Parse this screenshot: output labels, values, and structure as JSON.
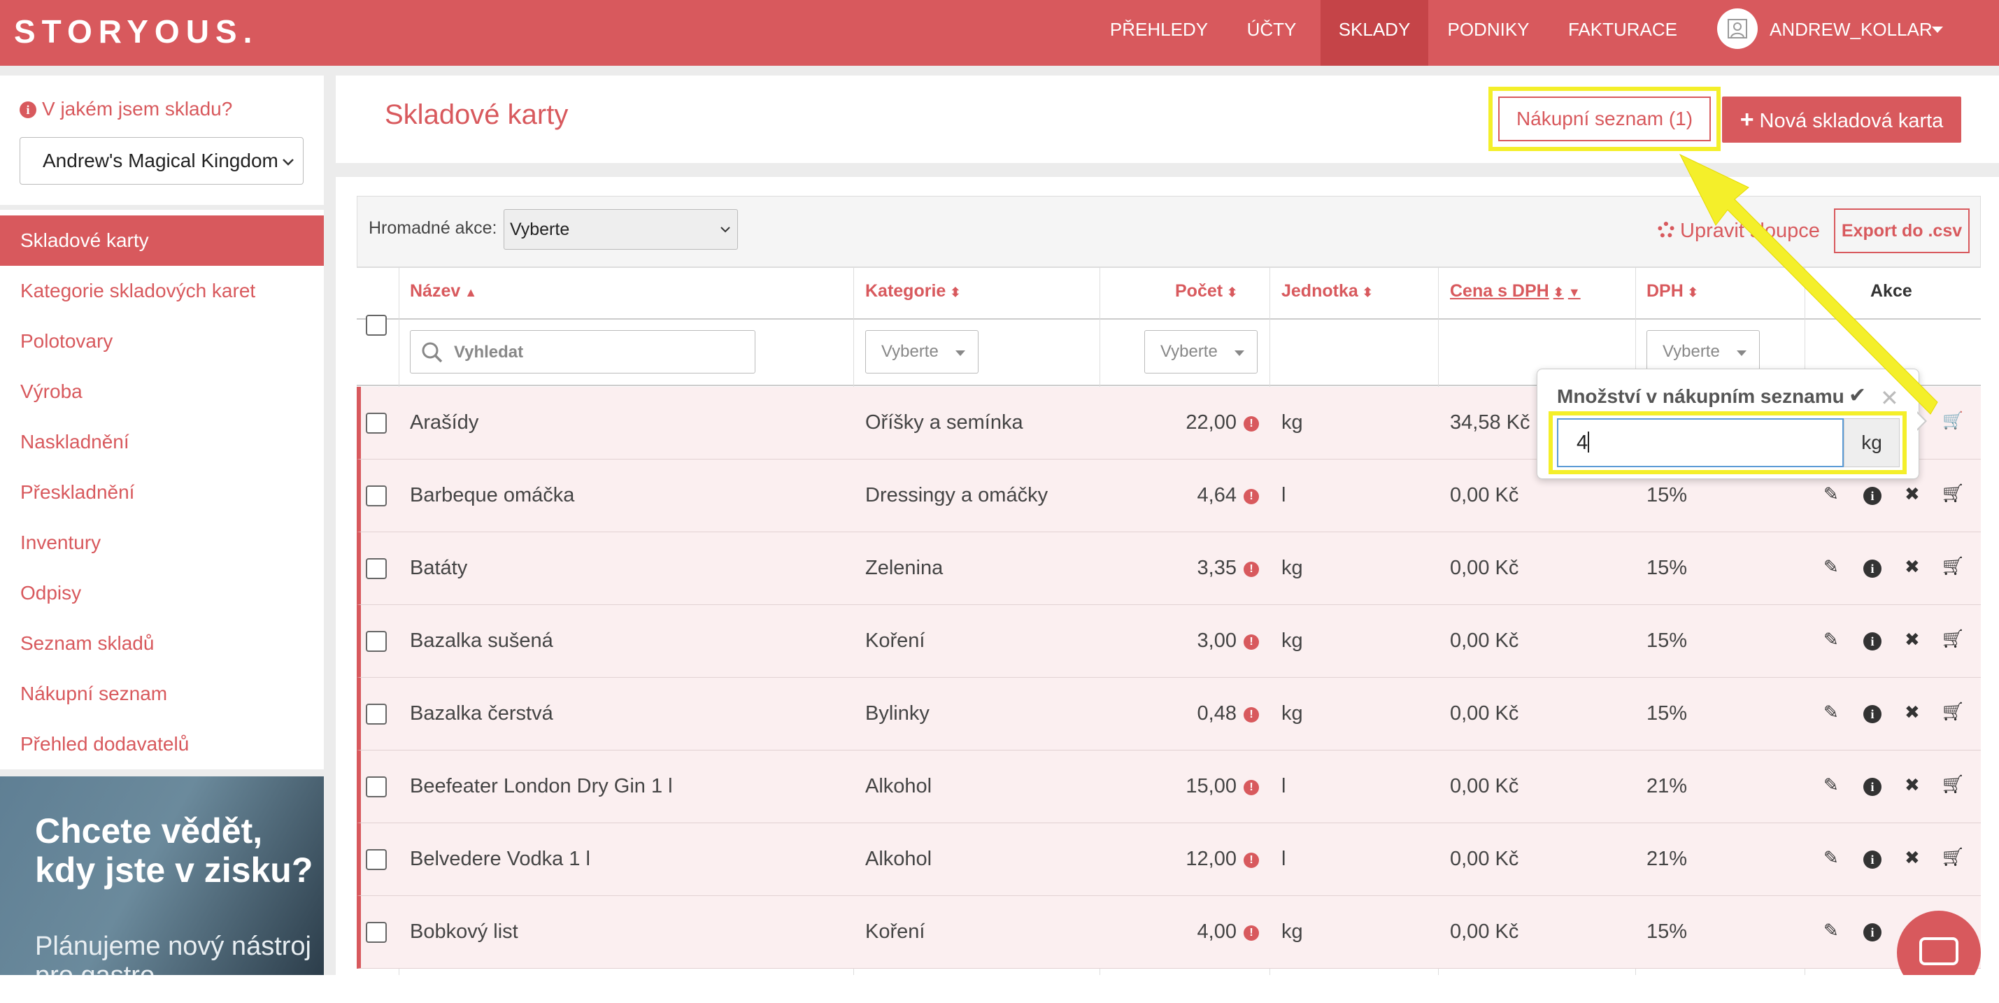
{
  "brand": {
    "logo": "STORYOUS."
  },
  "nav": {
    "items": [
      "PŘEHLEDY",
      "ÚČTY",
      "SKLADY",
      "PODNIKY",
      "FAKTURACE"
    ],
    "active": "SKLADY",
    "user": "ANDREW_KOLLAR"
  },
  "sidebar": {
    "which_warehouse": "V jakém jsem skladu?",
    "warehouse_value": "Andrew's Magical Kingdom",
    "items": [
      "Skladové karty",
      "Kategorie skladových karet",
      "Polotovary",
      "Výroba",
      "Naskladnění",
      "Přeskladnění",
      "Inventury",
      "Odpisy",
      "Seznam skladů",
      "Nákupní seznam",
      "Přehled dodavatelů"
    ],
    "active_index": 0,
    "promo_title": "Chcete vědět, kdy jste v zisku?",
    "promo_sub": "Plánujeme nový nástroj pro gastro"
  },
  "header": {
    "title": "Skladové karty",
    "shopping_list_button": "Nákupní seznam (1)",
    "new_card_button": "Nová skladová karta"
  },
  "toolbar": {
    "bulk_label": "Hromadné akce:",
    "bulk_value": "Vyberte",
    "edit_columns": "Upravit sloupce",
    "export": "Export do .csv"
  },
  "table": {
    "headers": [
      "Název",
      "Kategorie",
      "Počet",
      "Jednotka",
      "Cena s DPH",
      "DPH",
      "Akce"
    ],
    "search_placeholder": "Vyhledat",
    "filter_placeholder": "Vyberte",
    "rows": [
      {
        "name": "Arašídy",
        "category": "Oříšky a semínka",
        "count": "22,00",
        "unit": "kg",
        "price": "34,58 Kč",
        "vat": ""
      },
      {
        "name": "Barbeque omáčka",
        "category": "Dressingy a omáčky",
        "count": "4,64",
        "unit": "l",
        "price": "0,00 Kč",
        "vat": "15%"
      },
      {
        "name": "Batáty",
        "category": "Zelenina",
        "count": "3,35",
        "unit": "kg",
        "price": "0,00 Kč",
        "vat": "15%"
      },
      {
        "name": "Bazalka sušená",
        "category": "Koření",
        "count": "3,00",
        "unit": "kg",
        "price": "0,00 Kč",
        "vat": "15%"
      },
      {
        "name": "Bazalka čerstvá",
        "category": "Bylinky",
        "count": "0,48",
        "unit": "kg",
        "price": "0,00 Kč",
        "vat": "15%"
      },
      {
        "name": "Beefeater London Dry Gin 1 l",
        "category": "Alkohol",
        "count": "15,00",
        "unit": "l",
        "price": "0,00 Kč",
        "vat": "21%"
      },
      {
        "name": "Belvedere Vodka 1 l",
        "category": "Alkohol",
        "count": "12,00",
        "unit": "l",
        "price": "0,00 Kč",
        "vat": "21%"
      },
      {
        "name": "Bobkový list",
        "category": "Koření",
        "count": "4,00",
        "unit": "kg",
        "price": "0,00 Kč",
        "vat": "15%"
      }
    ]
  },
  "popover": {
    "title": "Množství v nákupním seznamu",
    "value": "4",
    "unit": "kg"
  },
  "colors": {
    "brand": "#d8595d",
    "highlight": "#f4ef2a"
  }
}
